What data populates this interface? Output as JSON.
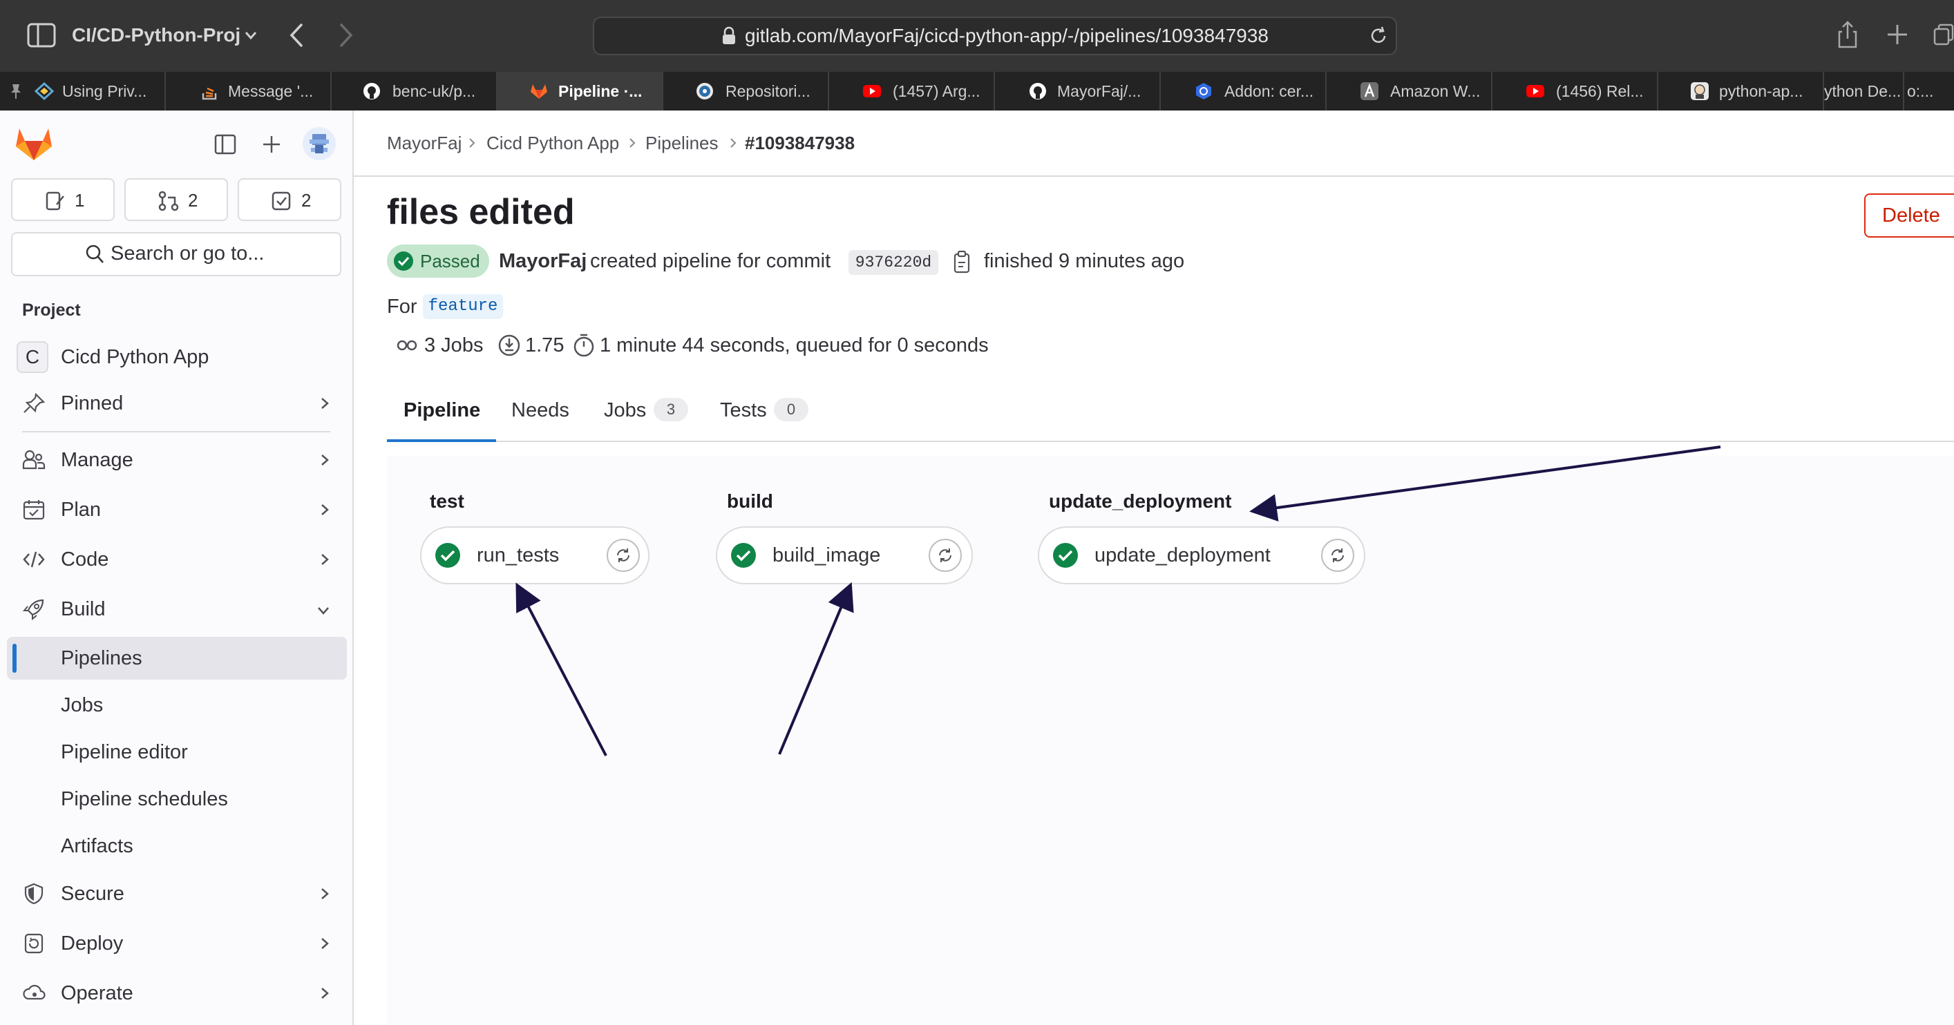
{
  "browser": {
    "project_selector": "CI/CD-Python-Proj",
    "url": "gitlab.com/MayorFaj/cicd-python-app/-/pipelines/1093847938",
    "tabs": [
      {
        "label": "Using Priv..."
      },
      {
        "label": "Message '..."
      },
      {
        "label": "benc-uk/p..."
      },
      {
        "label": "Pipeline ·..."
      },
      {
        "label": "Repositori..."
      },
      {
        "label": "(1457) Arg..."
      },
      {
        "label": "MayorFaj/..."
      },
      {
        "label": "Addon: cer..."
      },
      {
        "label": "Amazon W..."
      },
      {
        "label": "(1456) Rel..."
      },
      {
        "label": "python-ap..."
      },
      {
        "label": "ython De..."
      },
      {
        "label": "o:..."
      }
    ]
  },
  "sidebar": {
    "counters": {
      "issues": "1",
      "merge_requests": "2",
      "todos": "2"
    },
    "search_placeholder": "Search or go to...",
    "section_label": "Project",
    "project_initial": "C",
    "project_name": "Cicd Python App",
    "nav": {
      "pinned": "Pinned",
      "manage": "Manage",
      "plan": "Plan",
      "code": "Code",
      "build": "Build",
      "secure": "Secure",
      "deploy": "Deploy",
      "operate": "Operate"
    },
    "build_items": {
      "pipelines": "Pipelines",
      "jobs": "Jobs",
      "pipeline_editor": "Pipeline editor",
      "pipeline_schedules": "Pipeline schedules",
      "artifacts": "Artifacts"
    }
  },
  "breadcrumb": [
    "MayorFaj",
    "Cicd Python App",
    "Pipelines",
    "#1093847938"
  ],
  "pipeline": {
    "title": "files edited",
    "delete_label": "Delete",
    "status": "Passed",
    "author": "MayorFaj",
    "created_text": "created pipeline for commit",
    "commit_sha": "9376220d",
    "finished_text": "finished 9 minutes ago",
    "for_label": "For",
    "ref": "feature",
    "jobs_count_text": "3 Jobs",
    "compute_value": "1.75",
    "duration_text": "1 minute 44 seconds, queued for 0 seconds"
  },
  "tabs": {
    "pipeline": "Pipeline",
    "needs": "Needs",
    "jobs": "Jobs",
    "jobs_count": "3",
    "tests": "Tests",
    "tests_count": "0"
  },
  "stages": [
    {
      "name": "test",
      "job": "run_tests",
      "status": "passed"
    },
    {
      "name": "build",
      "job": "build_image",
      "status": "passed"
    },
    {
      "name": "update_deployment",
      "job": "update_deployment",
      "status": "passed"
    }
  ],
  "colors": {
    "success": "#108548",
    "success_bg": "#c3e6cd",
    "danger": "#dd2b0e",
    "link": "#1f75cb",
    "gitlab_orange": "#fc6d26",
    "annotation_arrow": "#1a1446"
  }
}
